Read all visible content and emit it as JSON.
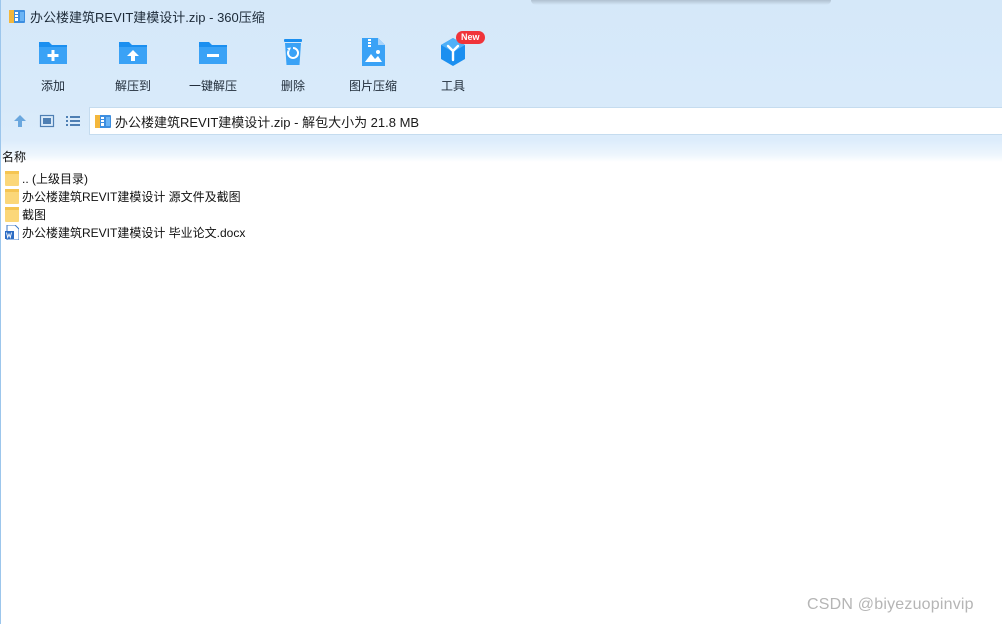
{
  "window": {
    "title": "办公楼建筑REVIT建模设计.zip - 360压缩"
  },
  "toolbar": {
    "items": [
      {
        "label": "添加",
        "icon": "add-folder-icon"
      },
      {
        "label": "解压到",
        "icon": "extract-to-icon"
      },
      {
        "label": "一键解压",
        "icon": "one-click-extract-icon"
      },
      {
        "label": "删除",
        "icon": "recycle-bin-icon"
      },
      {
        "label": "图片压缩",
        "icon": "image-compress-icon"
      },
      {
        "label": "工具",
        "icon": "tools-cube-icon",
        "badge": "New"
      }
    ]
  },
  "navigation": {
    "up_icon": "up-arrow-icon",
    "view_icon": "thumbnail-view-icon",
    "list_icon": "list-view-icon",
    "path": "办公楼建筑REVIT建模设计.zip - 解包大小为 21.8 MB"
  },
  "filelist": {
    "column_name": "名称",
    "rows": [
      {
        "name": ".. (上级目录)",
        "type": "folder"
      },
      {
        "name": "办公楼建筑REVIT建模设计 源文件及截图",
        "type": "folder"
      },
      {
        "name": "截图",
        "type": "folder"
      },
      {
        "name": "办公楼建筑REVIT建模设计 毕业论文.docx",
        "type": "docx"
      }
    ]
  },
  "watermark": "CSDN @biyezuopinvip",
  "colors": {
    "accent": "#1b8ff0",
    "header_bg": "#d8eafa",
    "folder": "#fbd779",
    "badge": "#f0343a"
  }
}
